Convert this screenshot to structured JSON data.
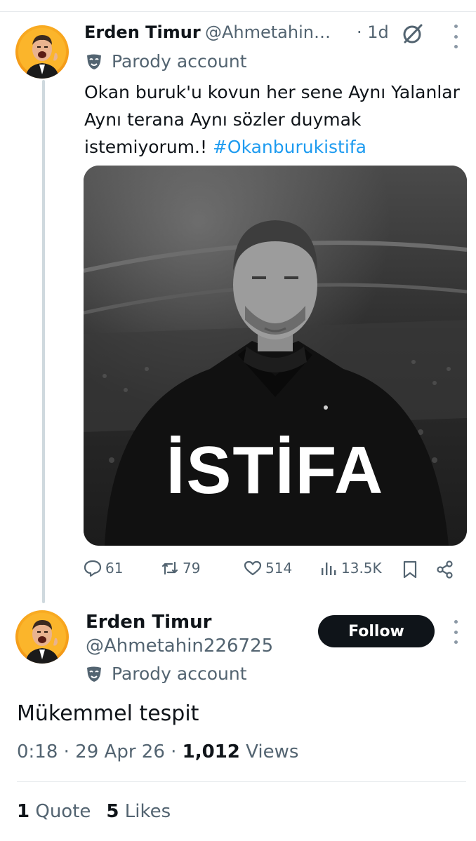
{
  "tweet": {
    "display_name": "Erden Timur",
    "handle": "@Ahmetahin…",
    "time": "· 1d",
    "badge": "Parody account",
    "text_main": "Okan buruk'u kovun her sene Aynı Yalanlar Aynı terana Aynı sözler duymak istemiyorum.! ",
    "hashtag": "#Okanburukistifa",
    "media_text": "İSTİFA",
    "actions": {
      "replies": "61",
      "reposts": "79",
      "likes": "514",
      "views": "13.5K"
    }
  },
  "reply": {
    "display_name": "Erden Timur",
    "handle": "@Ahmetahin226725",
    "badge": "Parody account",
    "follow_label": "Follow",
    "text": "Mükemmel tespit",
    "meta_time": "0:18 · 29 Apr 26 · ",
    "views_count": "1,012",
    "views_label": " Views",
    "quotes_count": "1",
    "quotes_label": " Quote",
    "likes_count": "5",
    "likes_label": " Likes"
  },
  "colors": {
    "text": "#0f1419",
    "secondary": "#536471",
    "link": "#1d9bf0",
    "button": "#0f1419"
  },
  "icons": [
    "reply-icon",
    "repost-icon",
    "like-icon",
    "views-icon",
    "bookmark-icon",
    "share-icon",
    "grok-icon",
    "more-icon",
    "parody-mask-icon"
  ]
}
